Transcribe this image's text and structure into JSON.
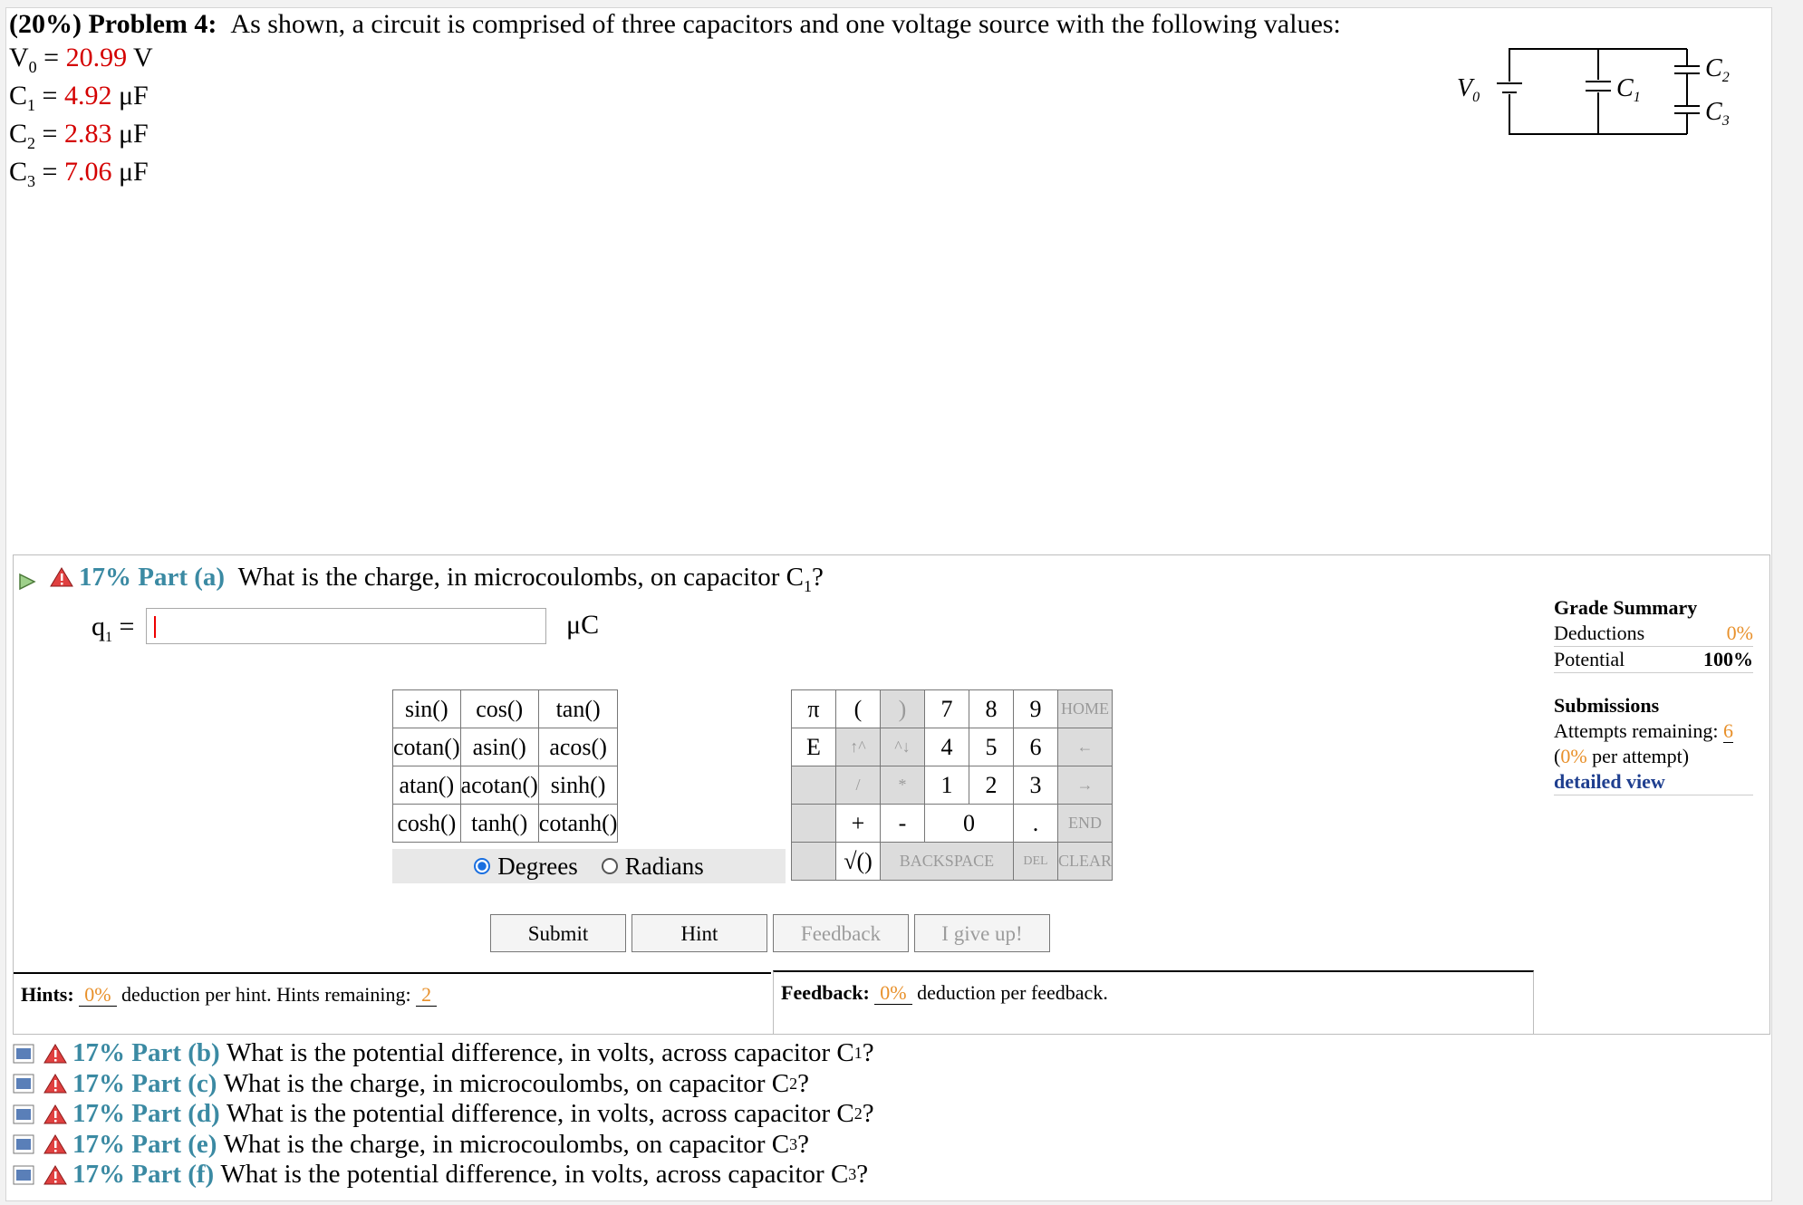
{
  "problem": {
    "weight": "(20%)",
    "label": "Problem 4:",
    "text": "As shown, a circuit is comprised of three capacitors and one voltage source with the following values:",
    "values": [
      {
        "name": "V",
        "sub": "0",
        "eq": " = ",
        "value": "20.99",
        "unit": " V"
      },
      {
        "name": "C",
        "sub": "1",
        "eq": " = ",
        "value": "4.92",
        "unit": " μF"
      },
      {
        "name": "C",
        "sub": "2",
        "eq": " = ",
        "value": "2.83",
        "unit": " μF"
      },
      {
        "name": "C",
        "sub": "3",
        "eq": " = ",
        "value": "7.06",
        "unit": " μF"
      }
    ],
    "circuit_labels": {
      "v0": "V",
      "v0_sub": "0",
      "c1": "C",
      "c1_sub": "1",
      "c2": "C",
      "c2_sub": "2",
      "c3": "C",
      "c3_sub": "3"
    }
  },
  "part_a": {
    "label": "17% Part (a)",
    "question": "What is the charge, in microcoulombs, on capacitor C",
    "question_sub": "1",
    "question_end": "?",
    "var": "q",
    "var_sub": "1",
    "eq": " =",
    "input_value": "",
    "unit": "μC"
  },
  "keypad": {
    "functions": [
      [
        "sin()",
        "cos()",
        "tan()"
      ],
      [
        "cotan()",
        "asin()",
        "acos()"
      ],
      [
        "atan()",
        "acotan()",
        "sinh()"
      ],
      [
        "cosh()",
        "tanh()",
        "cotanh()"
      ]
    ],
    "degrees_label": "Degrees",
    "radians_label": "Radians",
    "angle_mode": "Degrees",
    "keys": {
      "pi": "π",
      "lparen": "(",
      "rparen": ")",
      "e": "E",
      "up": "↑^",
      "down": "^↓",
      "slash": "/",
      "star": "*",
      "plus": "+",
      "minus": "-",
      "zero": "0",
      "dot": ".",
      "sqrt": "√()",
      "backspace": "BACKSPACE",
      "del": "DEL",
      "clear": "CLEAR",
      "home": "HOME",
      "left": "←",
      "right": "→",
      "end": "END",
      "digits": [
        "7",
        "8",
        "9",
        "4",
        "5",
        "6",
        "1",
        "2",
        "3"
      ]
    }
  },
  "buttons": {
    "submit": "Submit",
    "hint": "Hint",
    "feedback": "Feedback",
    "give_up": "I give up!"
  },
  "hints": {
    "label": "Hints:",
    "pct": "0%",
    "text": "deduction per hint. Hints remaining:",
    "remaining": "2"
  },
  "feedback": {
    "label": "Feedback:",
    "pct": "0%",
    "text": "deduction per feedback."
  },
  "grade_summary": {
    "title": "Grade Summary",
    "deductions_label": "Deductions",
    "deductions": "0%",
    "potential_label": "Potential",
    "potential": "100%",
    "submissions_title": "Submissions",
    "attempts_label": "Attempts remaining:",
    "attempts": "6",
    "per_attempt_open": "(",
    "per_attempt_pct": "0%",
    "per_attempt_text": " per attempt)",
    "detailed_view": "detailed view"
  },
  "other_parts": [
    {
      "label": "17% Part (b)",
      "q": "What is the potential difference, in volts, across capacitor C",
      "sub": "1",
      "end": "?"
    },
    {
      "label": "17% Part (c)",
      "q": "What is the charge, in microcoulombs, on capacitor C",
      "sub": "2",
      "end": "?"
    },
    {
      "label": "17% Part (d)",
      "q": "What is the potential difference, in volts, across capacitor C",
      "sub": "2",
      "end": "?"
    },
    {
      "label": "17% Part (e)",
      "q": "What is the charge, in microcoulombs, on capacitor C",
      "sub": "3",
      "end": "?"
    },
    {
      "label": "17% Part (f)",
      "q": "What is the potential difference, in volts, across capacitor C",
      "sub": "3",
      "end": "?"
    }
  ],
  "colors": {
    "value_red": "#d40000",
    "part_blue": "#3b8aa3",
    "accent_orange": "#e8902a",
    "link_blue": "#1f3f8f"
  }
}
